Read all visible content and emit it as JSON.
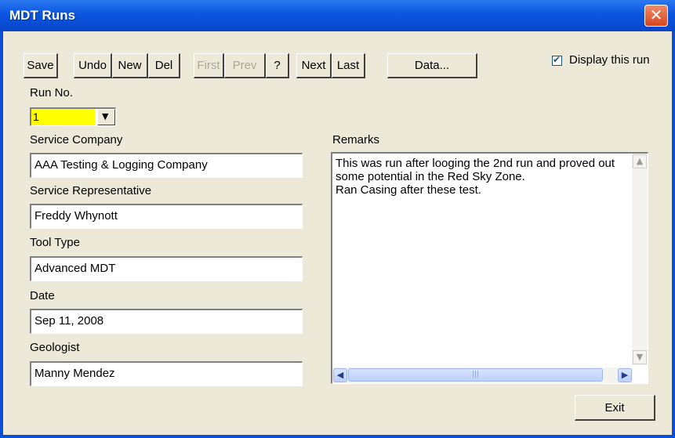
{
  "window": {
    "title": "MDT Runs",
    "close_glyph": "✕"
  },
  "toolbar": {
    "save": "Save",
    "undo": "Undo",
    "new": "New",
    "del": "Del",
    "first": "First",
    "prev": "Prev",
    "help": "?",
    "next": "Next",
    "last": "Last",
    "data": "Data..."
  },
  "display_run": {
    "label": "Display this run",
    "checked": true,
    "check_glyph": "✔"
  },
  "run_no": {
    "label": "Run No.",
    "value": "1",
    "arrow_glyph": "▼"
  },
  "fields": {
    "service_company": {
      "label": "Service Company",
      "value": "AAA Testing & Logging Company"
    },
    "service_rep": {
      "label": "Service Representative",
      "value": "Freddy Whynott"
    },
    "tool_type": {
      "label": "Tool Type",
      "value": "Advanced MDT"
    },
    "date": {
      "label": "Date",
      "value": "Sep 11, 2008"
    },
    "geologist": {
      "label": "Geologist",
      "value": "Manny Mendez"
    }
  },
  "remarks": {
    "label": "Remarks",
    "text": "This was run after looging the 2nd run and proved out some potential in the Red Sky Zone.\nRan Casing after these test."
  },
  "scroll": {
    "up": "▲",
    "down": "▼",
    "left": "◀",
    "right": "▶",
    "grip": "|||"
  },
  "exit": "Exit",
  "colors": {
    "titlebar": "#0b55e0",
    "dialog": "#ece9d8",
    "run_no_highlight": "#ffff00"
  }
}
